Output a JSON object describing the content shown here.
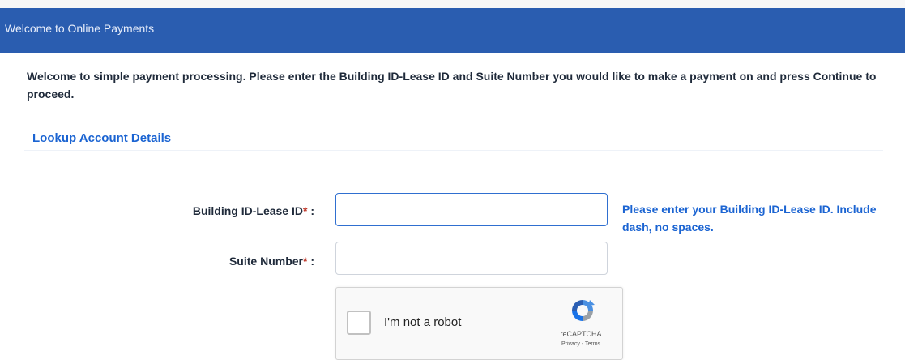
{
  "header": {
    "title": "Welcome to Online Payments",
    "bar_color": "#2a5db0"
  },
  "intro": {
    "text": "Welcome to simple payment processing. Please enter the Building ID-Lease ID and Suite Number you would like to make a payment on and press Continue to proceed."
  },
  "lookup": {
    "heading": "Lookup Account Details",
    "building_id": {
      "label": "Building ID-Lease ID",
      "required_marker": "*",
      "colon": ":",
      "value": "",
      "help": "Please enter your Building ID-Lease ID. Include dash, no spaces."
    },
    "suite": {
      "label": "Suite Number",
      "required_marker": "*",
      "colon": ":",
      "value": ""
    }
  },
  "captcha": {
    "label": "I'm not a robot",
    "brand": "reCAPTCHA",
    "links": "Privacy - Terms",
    "logo_icon": "recaptcha-logo-icon"
  },
  "colors": {
    "accent": "#1b64d2",
    "required": "#c0392b"
  }
}
